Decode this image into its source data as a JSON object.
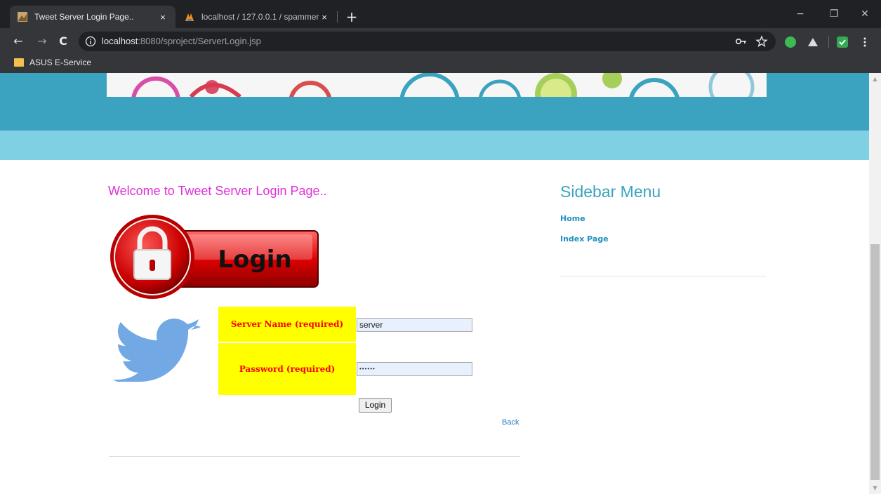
{
  "browser": {
    "tabs": [
      {
        "title": "Tweet Server Login Page..",
        "active": true
      },
      {
        "title": "localhost / 127.0.0.1 / spammer",
        "active": false
      }
    ],
    "tab_close": "×",
    "new_tab": "+",
    "window_controls": {
      "minimize": "−",
      "restore": "❐",
      "close": "✕"
    },
    "nav": {
      "back": "←",
      "forward": "→",
      "reload": "C"
    },
    "url": {
      "host": "localhost",
      "path": ":8080/sproject/ServerLogin.jsp"
    },
    "bookmarks": [
      {
        "label": "ASUS E-Service"
      }
    ]
  },
  "page": {
    "welcome": "Welcome to Tweet Server Login Page..",
    "login_graphic_text": "Login",
    "form": {
      "username_label": "Server Name (required)",
      "username_value": "server",
      "password_label": "Password (required)",
      "password_value": "••••••",
      "submit_label": "Login",
      "back_label": "Back"
    },
    "sidebar": {
      "title": "Sidebar Menu",
      "links": [
        {
          "label": "Home"
        },
        {
          "label": "Index Page"
        }
      ]
    }
  },
  "colors": {
    "header_dark": "#3ba3bf",
    "header_light": "#7fd0e3",
    "welcome_text": "#e030d8",
    "label_bg": "#ffff00",
    "label_text": "#ff0000",
    "sidebar_title": "#3aa3c0",
    "twitter_blue": "#72a9e4"
  }
}
